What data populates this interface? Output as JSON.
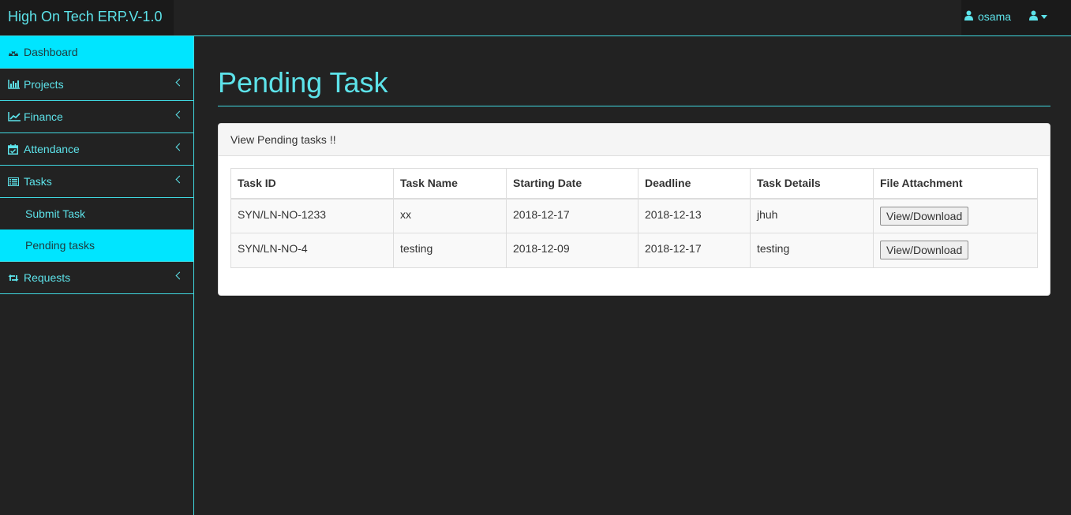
{
  "header": {
    "brand": "High On Tech ERP.V-1.0",
    "user_name": "osama",
    "user_icon": "user-icon"
  },
  "sidebar": {
    "items": [
      {
        "label": "Dashboard",
        "icon": "dashboard-icon",
        "active": true
      },
      {
        "label": "Projects",
        "icon": "bar-chart-icon"
      },
      {
        "label": "Finance",
        "icon": "line-chart-icon"
      },
      {
        "label": "Attendance",
        "icon": "calendar-check-icon"
      },
      {
        "label": "Tasks",
        "icon": "tasks-icon",
        "expanded": true,
        "children": [
          {
            "label": "Submit Task"
          },
          {
            "label": "Pending tasks",
            "active": true
          }
        ]
      },
      {
        "label": "Requests",
        "icon": "retweet-icon"
      }
    ]
  },
  "main": {
    "title": "Pending Task",
    "panel_heading": "View Pending tasks !!",
    "table": {
      "headers": [
        "Task ID",
        "Task Name",
        "Starting Date",
        "Deadline",
        "Task Details",
        "File Attachment"
      ],
      "rows": [
        {
          "id": "SYN/LN-NO-1233",
          "name": "xx",
          "start": "2018-12-17",
          "deadline": "2018-12-13",
          "details": "jhuh",
          "action": "View/Download"
        },
        {
          "id": "SYN/LN-NO-4",
          "name": "testing",
          "start": "2018-12-09",
          "deadline": "2018-12-17",
          "details": "testing",
          "action": "View/Download"
        }
      ]
    }
  },
  "colors": {
    "accent": "#5de3ea",
    "active_bg": "#00e5ff",
    "background": "#222222"
  }
}
